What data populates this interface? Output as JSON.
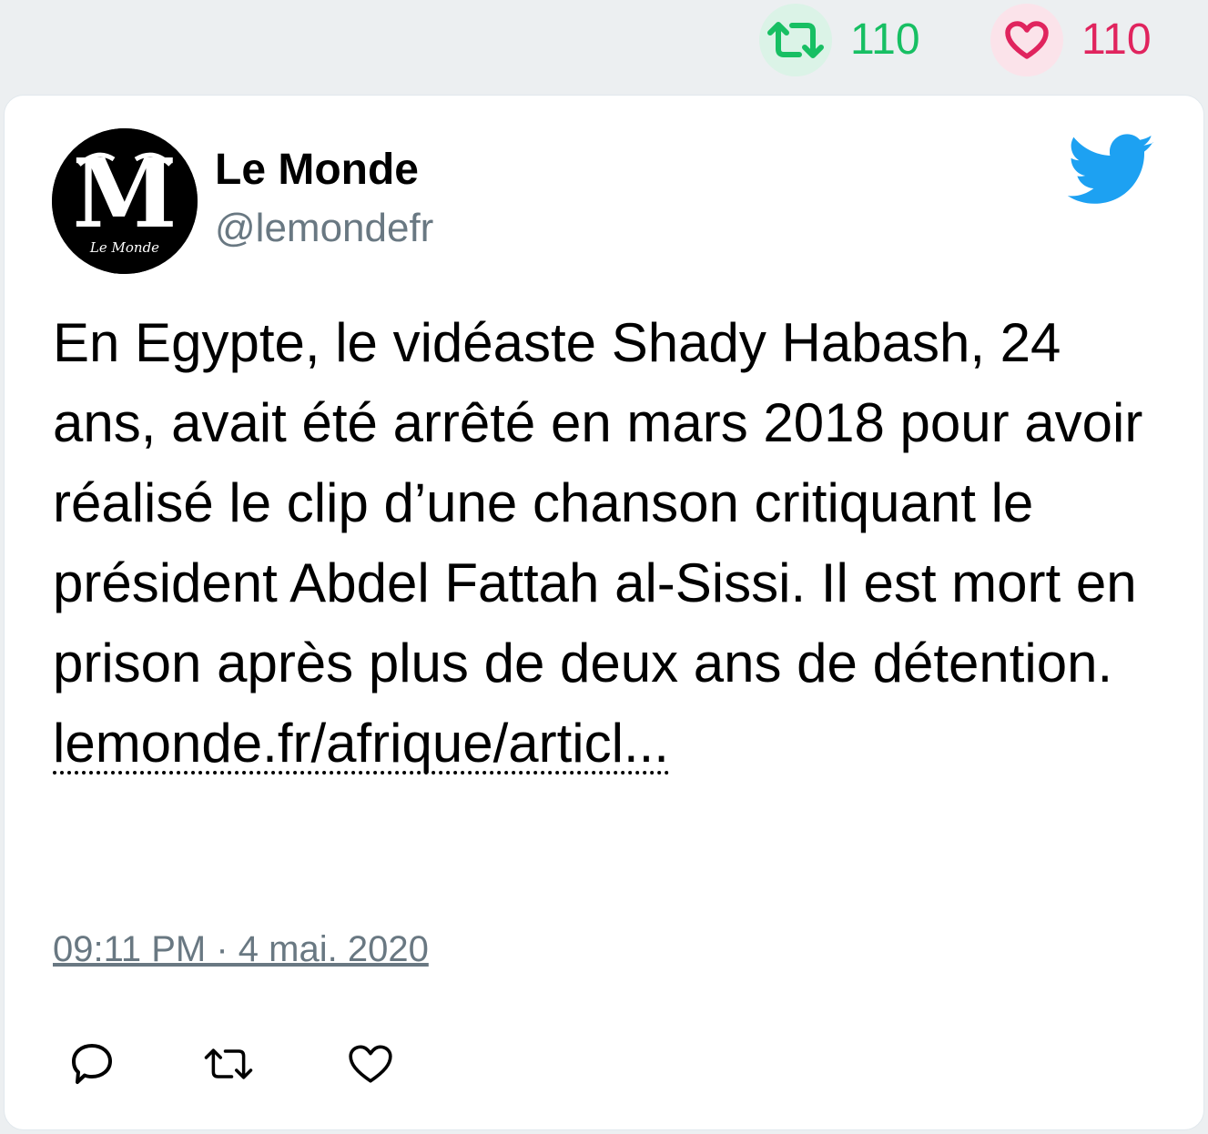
{
  "stats": {
    "retweets": "110",
    "likes": "110",
    "retweet_color": "#17bf63",
    "like_color": "#e0245e",
    "retweet_icon": "retweet-icon",
    "like_icon": "heart-icon"
  },
  "tweet": {
    "author_name": "Le Monde",
    "author_handle": "@lemondefr",
    "avatar_icon": "le-monde-logo",
    "platform_icon": "twitter-bird-icon",
    "platform_color": "#1da1f2",
    "text": "En Egypte, le vidéaste Shady Habash, 24 ans, avait été arrêté en mars 2018 pour avoir réalisé le clip d’une chanson critiquant le président Abdel Fattah al-Sissi. Il est mort en prison après plus de deux ans de détention.",
    "link_text": "lemonde.fr/afrique/articl...",
    "timestamp": "09:11 PM · 4 mai. 2020"
  },
  "actions": {
    "reply_icon": "reply-icon",
    "retweet_icon": "retweet-icon",
    "like_icon": "heart-icon"
  }
}
